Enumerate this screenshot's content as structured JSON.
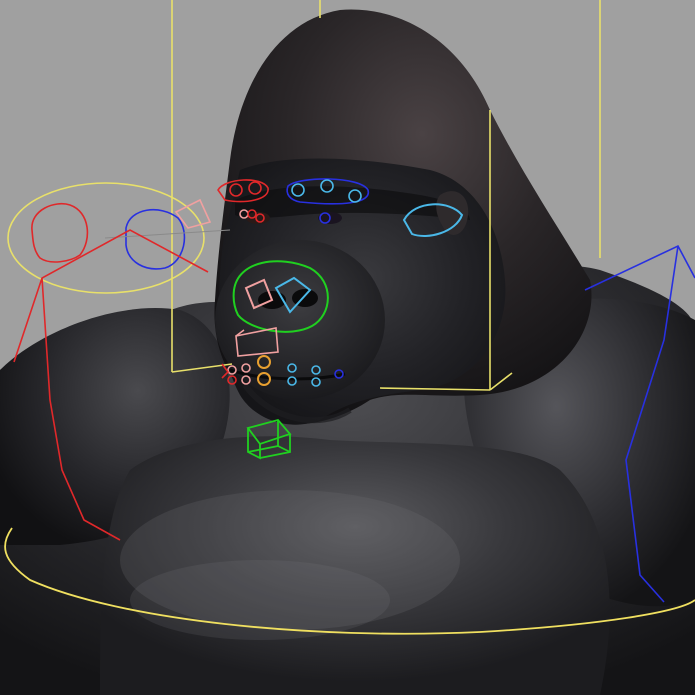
{
  "viewport": {
    "background": "#a0a0a0",
    "subject": "gorilla-character-model",
    "colors": {
      "skin_dark": "#1c1c1e",
      "skin_mid": "#3a3a3c",
      "skin_light": "#5a5a5c",
      "face_dark": "#141416",
      "bounding_box": "#e8e06a",
      "left_side_controls": "#e0282a",
      "right_side_controls": "#2830e0",
      "face_pink_controls": "#f0a0a0",
      "cyan_controls": "#4ab8e8",
      "green_controls": "#20d020",
      "orange_controls": "#e8a030",
      "root_circle": "#f0e060"
    }
  },
  "rig_controls": [
    {
      "name": "head-bounding-box",
      "color": "bounding_box"
    },
    {
      "name": "left-eye-look-control",
      "color": "left_side_controls"
    },
    {
      "name": "left-eye-outer-ring",
      "color": "bounding_box"
    },
    {
      "name": "right-eye-look-control",
      "color": "right_side_controls"
    },
    {
      "name": "left-brow-control",
      "color": "left_side_controls"
    },
    {
      "name": "right-brow-control",
      "color": "right_side_controls"
    },
    {
      "name": "right-eye-socket-control",
      "color": "cyan_controls"
    },
    {
      "name": "nose-control",
      "color": "green_controls"
    },
    {
      "name": "jaw-control",
      "color": "green_controls"
    },
    {
      "name": "mouth-corner-controls",
      "color": "orange_controls"
    },
    {
      "name": "lip-controls",
      "color": "cyan_controls"
    },
    {
      "name": "left-arm-ik-chain",
      "color": "left_side_controls"
    },
    {
      "name": "right-arm-ik-chain",
      "color": "right_side_controls"
    },
    {
      "name": "root-circle-control",
      "color": "root_circle"
    }
  ]
}
